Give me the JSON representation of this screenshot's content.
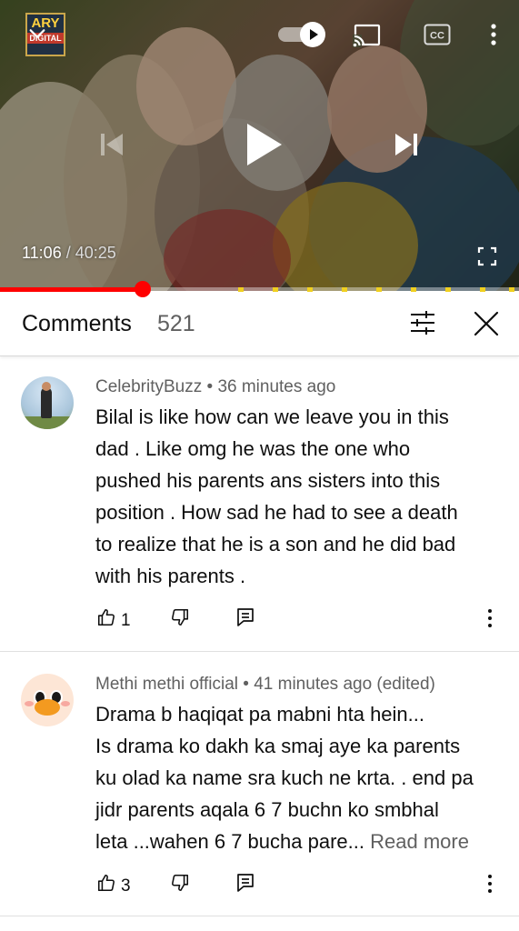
{
  "player": {
    "channel_logo": {
      "line1": "ARY",
      "line2": "DIGITAL"
    },
    "current_time": "11:06",
    "separator": "/",
    "duration": "40:25",
    "progress_fraction": 0.275,
    "icons": [
      "chevron-down-icon",
      "autoplay-toggle",
      "cast-icon",
      "captions-icon",
      "more-vert-icon",
      "skip-previous-icon",
      "play-icon",
      "skip-next-icon",
      "fullscreen-icon"
    ]
  },
  "comments_header": {
    "title": "Comments",
    "count": "521"
  },
  "comments": [
    {
      "author": "CelebrityBuzz",
      "dot": "•",
      "time": "36 minutes ago",
      "lines": [
        "Bilal is like how can we leave you in this",
        "dad . Like omg he was the one who",
        "pushed his parents ans sisters into this",
        "position . How sad he had to see a death",
        "to realize that he is a son and he did bad",
        "with his parents ."
      ],
      "likes": "1"
    },
    {
      "author": "Methi methi official",
      "dot": "•",
      "time": "41 minutes ago (edited)",
      "lines": [
        "Drama b haqiqat pa mabni hta hein...",
        "Is drama ko dakh ka smaj aye ka parents",
        "ku olad ka name sra kuch ne krta. . end pa",
        "jidr parents aqala 6 7 buchn ko smbhal",
        "leta ...wahen 6 7 bucha pare..."
      ],
      "read_more": "Read more",
      "likes": "3"
    }
  ]
}
